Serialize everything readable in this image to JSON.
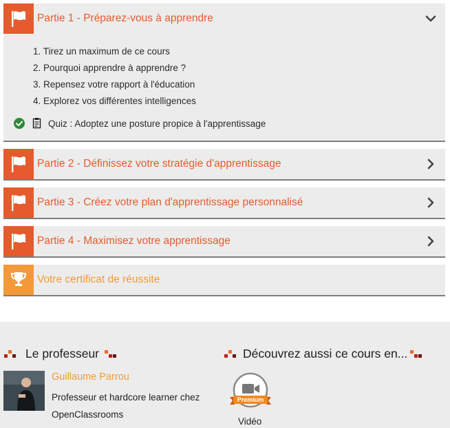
{
  "parts": [
    {
      "title": "Partie 1 - Préparez-vous à apprendre",
      "expanded": true,
      "chapters": [
        "1. Tirez un maximum de ce cours",
        "2. Pourquoi apprendre à apprendre ?",
        "3. Repensez votre rapport à l'éducation",
        "4. Explorez vos différentes intelligences"
      ],
      "quiz": "Quiz : Adoptez une posture propice à l'apprentissage"
    },
    {
      "title": "Partie 2 - Définissez votre stratégie d'apprentissage",
      "expanded": false
    },
    {
      "title": "Partie 3 - Créez votre plan d'apprentissage personnalisé",
      "expanded": false
    },
    {
      "title": "Partie 4 - Maximisez votre apprentissage",
      "expanded": false
    }
  ],
  "certificate": {
    "title": "Votre certificat de réussite"
  },
  "professor": {
    "section_title": "Le professeur",
    "name": "Guillaume Parrou",
    "description": "Professeur et hardcore learner chez OpenClassrooms"
  },
  "discover": {
    "section_title": "Découvrez aussi ce cours en...",
    "badge": "Premium",
    "format_label": "Vidéo"
  },
  "colors": {
    "accent": "#e55b2d",
    "certificate": "#f29a3a",
    "check": "#2e8b3a",
    "panel": "#ececec"
  },
  "icons": [
    "flag-icon",
    "chevron-down-icon",
    "chevron-right-icon",
    "check-icon",
    "quiz-icon",
    "trophy-icon",
    "video-camera-icon"
  ]
}
